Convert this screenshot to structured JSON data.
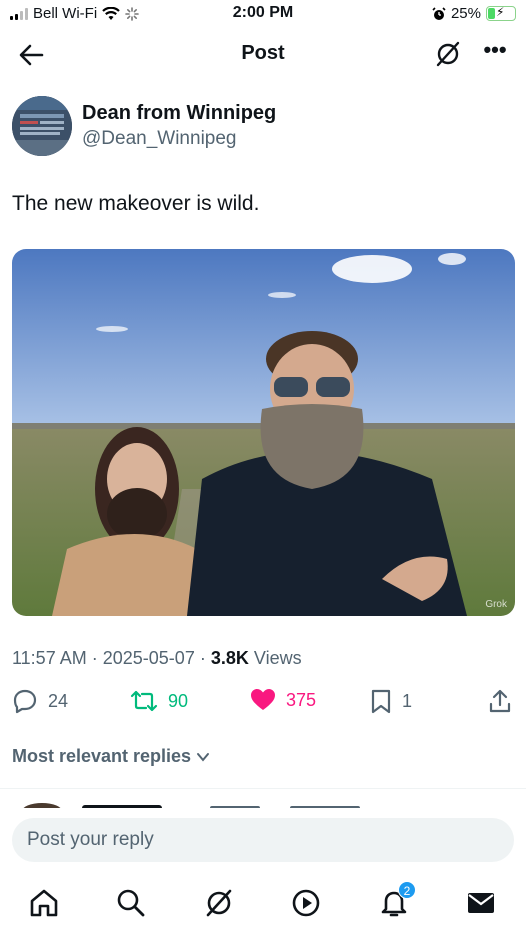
{
  "status_bar": {
    "carrier": "Bell Wi-Fi",
    "time": "2:00 PM",
    "battery": "25%",
    "battery_level": 0.25
  },
  "header": {
    "title": "Post"
  },
  "post": {
    "author_name": "Dean from Winnipeg",
    "author_handle": "@Dean_Winnipeg",
    "text": "The new makeover is wild.",
    "media_watermark": "Grok",
    "time": "11:57 AM",
    "date": "2025-05-07",
    "views_count": "3.8K",
    "views_label": "Views",
    "separator": "·"
  },
  "actions": {
    "replies": "24",
    "reposts": "90",
    "likes": "375",
    "bookmarks": "1"
  },
  "replies_filter": {
    "label": "Most relevant replies"
  },
  "reply_bar": {
    "placeholder": "Post your reply"
  },
  "tab_bar": {
    "notifications_badge": "2"
  },
  "colors": {
    "text_primary": "#0f1419",
    "text_secondary": "#536471",
    "repost_green": "#00ba7c",
    "like_pink": "#f91880",
    "accent_blue": "#1d9bf0"
  },
  "icons": [
    "signal-icon",
    "wifi-icon",
    "loading-icon",
    "alarm-icon",
    "battery-icon",
    "back-arrow-icon",
    "grok-icon",
    "more-icon",
    "reply-icon",
    "repost-icon",
    "heart-icon",
    "bookmark-icon",
    "share-icon",
    "chevron-down-icon",
    "home-icon",
    "search-icon",
    "grok-tab-icon",
    "play-icon",
    "bell-icon",
    "mail-icon"
  ]
}
